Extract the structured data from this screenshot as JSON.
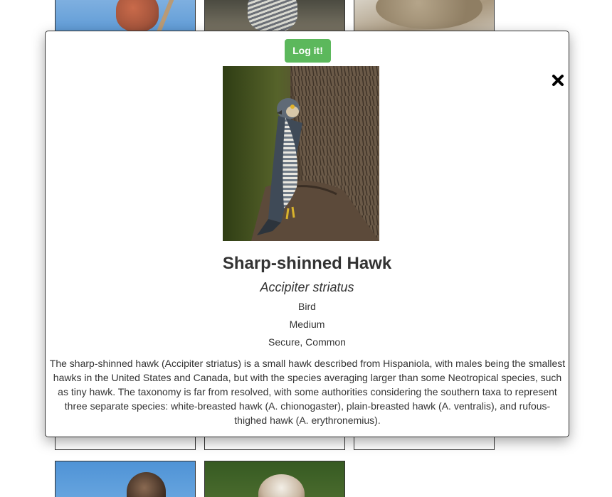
{
  "modal": {
    "log_button_label": "Log it!",
    "close_icon": "close-x-icon",
    "photo_alt": "Sharp-shinned Hawk",
    "common_name": "Sharp-shinned Hawk",
    "scientific_name": "Accipiter striatus",
    "type": "Bird",
    "size": "Medium",
    "status": "Secure, Common",
    "description": "The sharp-shinned hawk (Accipiter striatus) is a small hawk described from Hispaniola, with males being the smallest hawks in the United States and Canada, but with the species averaging larger than some Neotropical species, such as tiny hawk. The taxonomy is far from resolved, with some authorities considering the southern taxa to represent three separate species: white-breasted hawk (A. chionogaster), plain-breasted hawk (A. ventralis), and rufous-thighed hawk (A. erythronemius)."
  },
  "colors": {
    "button_green": "#5cb85c",
    "text": "#333333"
  }
}
